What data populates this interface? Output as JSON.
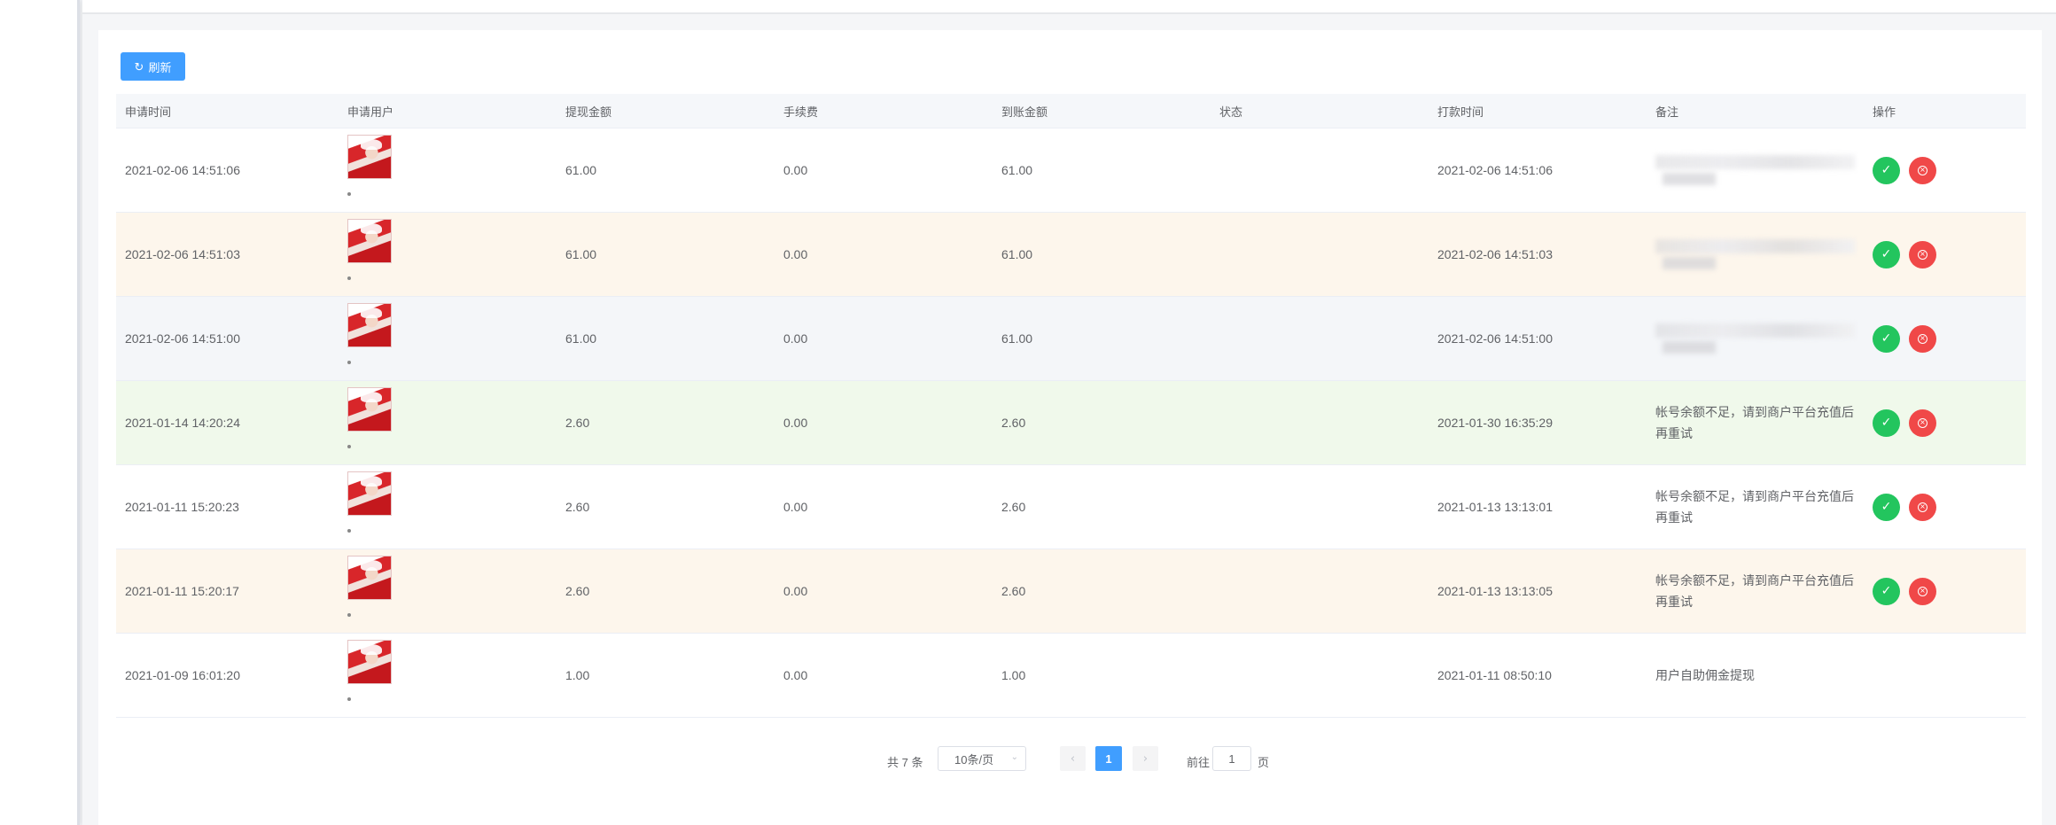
{
  "toolbar": {
    "refresh_label": "刷新"
  },
  "table": {
    "headers": [
      "申请时间",
      "申请用户",
      "提现金额",
      "手续费",
      "到账金额",
      "状态",
      "打款时间",
      "备注",
      "操作"
    ],
    "rows": [
      {
        "apply_time": "2021-02-06 14:51:06",
        "amount": "61.00",
        "fee": "0.00",
        "received": "61.00",
        "status": "",
        "pay_time": "2021-02-06 14:51:06",
        "remark": "",
        "remark_redacted": true,
        "bg": "c-white"
      },
      {
        "apply_time": "2021-02-06 14:51:03",
        "amount": "61.00",
        "fee": "0.00",
        "received": "61.00",
        "status": "",
        "pay_time": "2021-02-06 14:51:03",
        "remark": "",
        "remark_redacted": true,
        "bg": "c-orange"
      },
      {
        "apply_time": "2021-02-06 14:51:00",
        "amount": "61.00",
        "fee": "0.00",
        "received": "61.00",
        "status": "",
        "pay_time": "2021-02-06 14:51:00",
        "remark": "",
        "remark_redacted": true,
        "bg": "c-gray"
      },
      {
        "apply_time": "2021-01-14 14:20:24",
        "amount": "2.60",
        "fee": "0.00",
        "received": "2.60",
        "status": "",
        "pay_time": "2021-01-30 16:35:29",
        "remark": "帐号余额不足，请到商户平台充值后再重试",
        "remark_redacted": false,
        "bg": "c-green"
      },
      {
        "apply_time": "2021-01-11 15:20:23",
        "amount": "2.60",
        "fee": "0.00",
        "received": "2.60",
        "status": "",
        "pay_time": "2021-01-13 13:13:01",
        "remark": "帐号余额不足，请到商户平台充值后再重试",
        "remark_redacted": false,
        "bg": "c-white"
      },
      {
        "apply_time": "2021-01-11 15:20:17",
        "amount": "2.60",
        "fee": "0.00",
        "received": "2.60",
        "status": "",
        "pay_time": "2021-01-13 13:13:05",
        "remark": "帐号余额不足，请到商户平台充值后再重试",
        "remark_redacted": false,
        "bg": "c-orange"
      },
      {
        "apply_time": "2021-01-09 16:01:20",
        "amount": "1.00",
        "fee": "0.00",
        "received": "1.00",
        "status": "",
        "pay_time": "2021-01-11 08:50:10",
        "remark": "用户自助佣金提现",
        "remark_redacted": false,
        "bg": "c-white",
        "no_actions": true
      }
    ],
    "approve_icon": "check-icon",
    "reject_icon": "close-circle-icon"
  },
  "pagination": {
    "total_label": "共 7 条",
    "page_size_label": "10条/页",
    "current_page": "1",
    "goto_label": "前往",
    "page_suffix": "页",
    "jump_value": "1"
  },
  "colors": {
    "primary": "#409eff",
    "approve": "#23c55e",
    "reject": "#f04848"
  }
}
